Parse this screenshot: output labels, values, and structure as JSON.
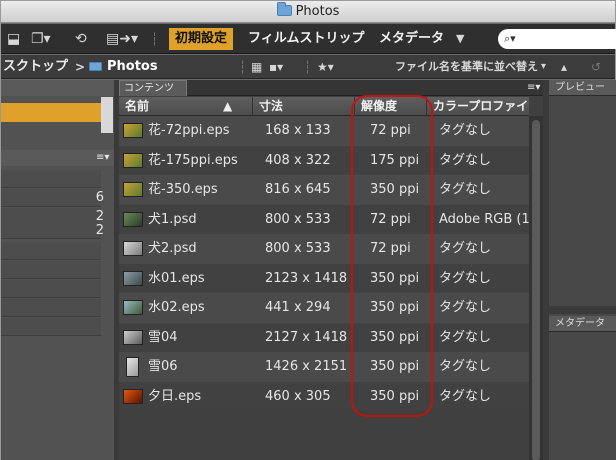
{
  "window": {
    "title": "Photos"
  },
  "toolbar": {
    "workspaces": [
      "初期設定",
      "フィルムストリップ",
      "メタデータ"
    ],
    "search_placeholder": "",
    "search_glyph": "⌕▾"
  },
  "pathbar": {
    "crumb_prev": "スクトップ",
    "separator": ">",
    "crumb_current": "Photos",
    "sort_label": "ファイル名を基準に並べ替え"
  },
  "left_panel": {
    "counts": [
      "6",
      "2",
      "2"
    ]
  },
  "content": {
    "tab_label": "コンテンツ",
    "columns": [
      "名前",
      "寸法",
      "解像度",
      "カラープロファイ"
    ],
    "rows": [
      {
        "name": "花-72ppi.eps",
        "dims": "168 x 133",
        "res": "72 ppi",
        "profile": "タグなし"
      },
      {
        "name": "花-175ppi.eps",
        "dims": "408 x 322",
        "res": "175 ppi",
        "profile": "タグなし"
      },
      {
        "name": "花-350.eps",
        "dims": "816 x 645",
        "res": "350 ppi",
        "profile": "タグなし"
      },
      {
        "name": "犬1.psd",
        "dims": "800 x 533",
        "res": "72 ppi",
        "profile": "Adobe RGB (1"
      },
      {
        "name": "犬2.psd",
        "dims": "800 x 533",
        "res": "72 ppi",
        "profile": "タグなし"
      },
      {
        "name": "水01.eps",
        "dims": "2123 x 1418",
        "res": "350 ppi",
        "profile": "タグなし"
      },
      {
        "name": "水02.eps",
        "dims": "441 x 294",
        "res": "350 ppi",
        "profile": "タグなし"
      },
      {
        "name": "雪04",
        "dims": "2127 x 1418",
        "res": "350 ppi",
        "profile": "タグなし"
      },
      {
        "name": "雪06",
        "dims": "1426 x 2151",
        "res": "350 ppi",
        "profile": "タグなし"
      },
      {
        "name": "夕日.eps",
        "dims": "460 x 305",
        "res": "350 ppi",
        "profile": "タグなし"
      }
    ]
  },
  "right_panel": {
    "preview_title": "プレビュー",
    "metadata_title": "メタデータ"
  },
  "colors": {
    "accent": "#dfa12a",
    "highlight_box": "#c41212"
  }
}
